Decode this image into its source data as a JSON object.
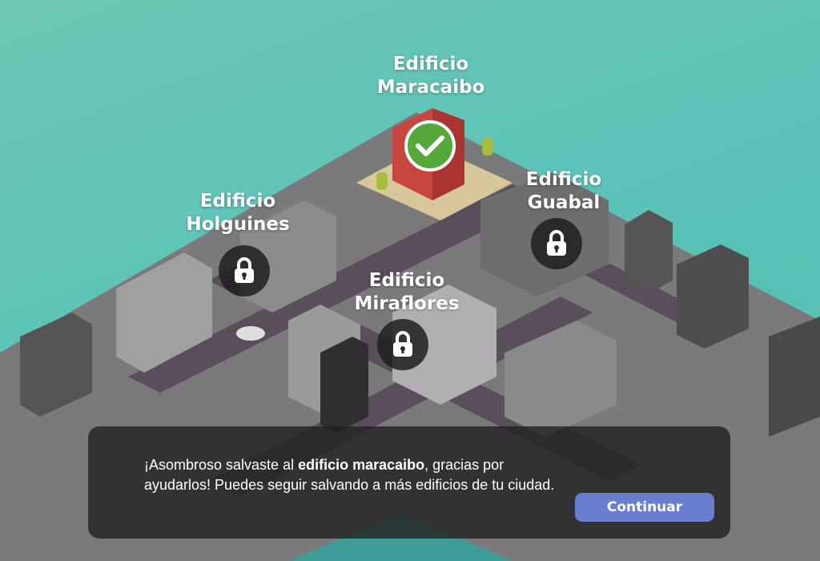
{
  "buildings": [
    {
      "id": "maracaibo",
      "label": "Edificio\nMaracaibo",
      "status": "saved",
      "icon": "check-icon"
    },
    {
      "id": "holguines",
      "label": "Edificio\nHolguines",
      "status": "locked",
      "icon": "lock-icon"
    },
    {
      "id": "guabal",
      "label": "Edificio\nGuabal",
      "status": "locked",
      "icon": "lock-icon"
    },
    {
      "id": "miraflores",
      "label": "Edificio\nMiraflores",
      "status": "locked",
      "icon": "lock-icon"
    }
  ],
  "dialog": {
    "message_prefix": "¡Asombroso salvaste al ",
    "message_bold": "edificio maracaibo",
    "message_suffix": ", gracias por ayudarlos! Puedes seguir salvando a más edificios de tu ciudad.",
    "continue_label": "Continuar"
  },
  "colors": {
    "sky": "#5cc3b8",
    "saved": "#55a83a",
    "button": "#6a7ecf",
    "road": "#5a4d5c",
    "red_building": "#c8463f"
  }
}
